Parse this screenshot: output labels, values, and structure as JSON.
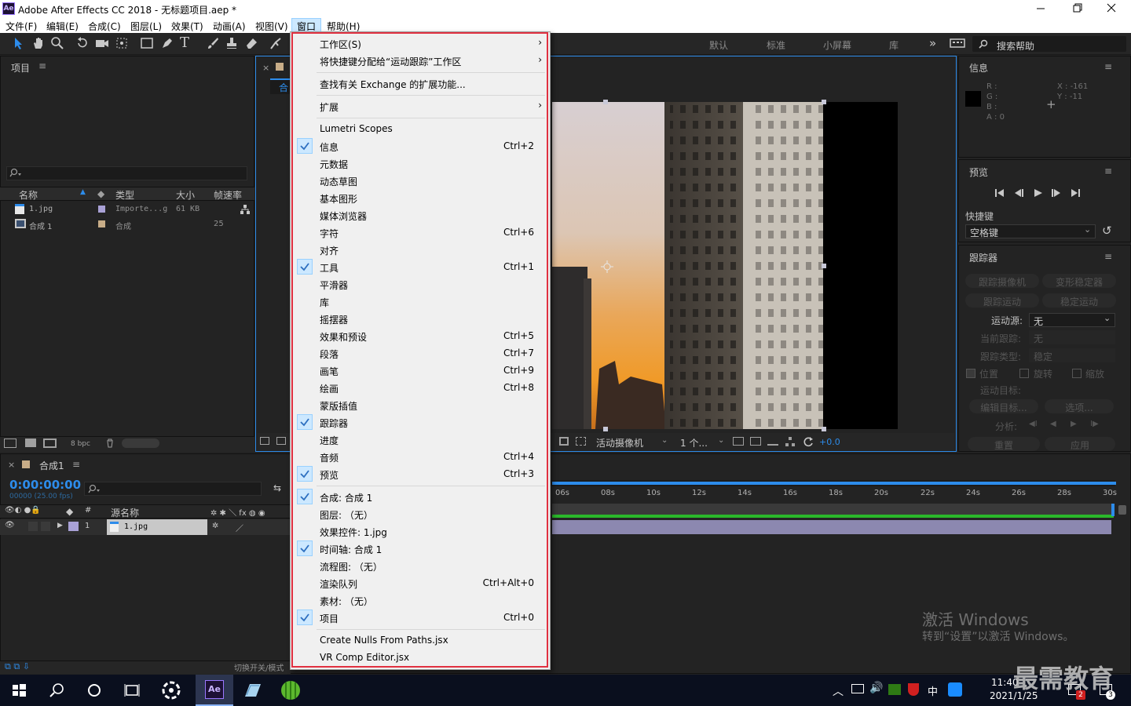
{
  "window": {
    "app_badge": "Ae",
    "title": "Adobe After Effects CC 2018 - 无标题项目.aep *"
  },
  "menubar": [
    "文件(F)",
    "编辑(E)",
    "合成(C)",
    "图层(L)",
    "效果(T)",
    "动画(A)",
    "视图(V)",
    "窗口",
    "帮助(H)"
  ],
  "workspaces": {
    "items": [
      "默认",
      "标准",
      "小屏幕",
      "库"
    ],
    "more": "»",
    "search_placeholder": "搜索帮助"
  },
  "project": {
    "title": "项目",
    "columns": [
      "名称",
      "类型",
      "大小",
      "帧速率"
    ],
    "rows": [
      {
        "name": "1.jpg",
        "type": "Importe...g",
        "size": "61 KB",
        "fps": ""
      },
      {
        "name": "合成 1",
        "type": "合成",
        "size": "",
        "fps": "25"
      }
    ],
    "bpc": "8 bpc"
  },
  "viewer": {
    "tab_label": "合",
    "camera": "活动摄像机",
    "views": "1 个...",
    "exposure": "+0.0"
  },
  "info": {
    "title": "信息",
    "r": "R :",
    "g": "G :",
    "b": "B :",
    "a": "A : 0",
    "x": "X : -161",
    "y": "Y : -11"
  },
  "preview": {
    "title": "预览",
    "shortcut_label": "快捷键",
    "shortcut_value": "空格键"
  },
  "tracker": {
    "title": "跟踪器",
    "track_camera": "跟踪摄像机",
    "warp_stabilizer": "变形稳定器",
    "track_motion": "跟踪运动",
    "stabilize_motion": "稳定运动",
    "motion_source_label": "运动源:",
    "motion_source": "无",
    "current_track_label": "当前跟踪:",
    "current_track": "无",
    "track_type_label": "跟踪类型:",
    "track_type": "稳定",
    "position": "位置",
    "rotation": "旋转",
    "scale": "缩放",
    "motion_target": "运动目标:",
    "edit_target": "编辑目标...",
    "options": "选项...",
    "analyze": "分析:",
    "reset": "重置",
    "apply": "应用"
  },
  "timeline": {
    "comp_tab": "合成1",
    "timecode": "0:00:00:00",
    "frames": "00000 (25.00 fps)",
    "layer_col": "源名称",
    "hash_col": "#",
    "layer_num": "1",
    "layer_name": "1.jpg",
    "ruler": [
      "06s",
      "08s",
      "10s",
      "12s",
      "14s",
      "16s",
      "18s",
      "20s",
      "22s",
      "24s",
      "26s",
      "28s",
      "30s"
    ],
    "footer": "切换开关/模式"
  },
  "window_menu": {
    "items": [
      {
        "label": "工作区(S)",
        "shortcut": "",
        "submenu": true,
        "checked": false
      },
      {
        "label": "将快捷键分配给“运动跟踪”工作区",
        "shortcut": "",
        "submenu": true,
        "checked": false
      },
      {
        "label": "查找有关 Exchange 的扩展功能...",
        "shortcut": "",
        "submenu": false,
        "checked": false
      },
      {
        "label": "扩展",
        "shortcut": "",
        "submenu": true,
        "checked": false
      },
      {
        "label": "Lumetri Scopes",
        "shortcut": "",
        "submenu": false,
        "checked": false
      },
      {
        "label": "信息",
        "shortcut": "Ctrl+2",
        "submenu": false,
        "checked": true
      },
      {
        "label": "元数据",
        "shortcut": "",
        "submenu": false,
        "checked": false
      },
      {
        "label": "动态草图",
        "shortcut": "",
        "submenu": false,
        "checked": false
      },
      {
        "label": "基本图形",
        "shortcut": "",
        "submenu": false,
        "checked": false
      },
      {
        "label": "媒体浏览器",
        "shortcut": "",
        "submenu": false,
        "checked": false
      },
      {
        "label": "字符",
        "shortcut": "Ctrl+6",
        "submenu": false,
        "checked": false
      },
      {
        "label": "对齐",
        "shortcut": "",
        "submenu": false,
        "checked": false
      },
      {
        "label": "工具",
        "shortcut": "Ctrl+1",
        "submenu": false,
        "checked": true
      },
      {
        "label": "平滑器",
        "shortcut": "",
        "submenu": false,
        "checked": false
      },
      {
        "label": "库",
        "shortcut": "",
        "submenu": false,
        "checked": false
      },
      {
        "label": "摇摆器",
        "shortcut": "",
        "submenu": false,
        "checked": false
      },
      {
        "label": "效果和预设",
        "shortcut": "Ctrl+5",
        "submenu": false,
        "checked": false
      },
      {
        "label": "段落",
        "shortcut": "Ctrl+7",
        "submenu": false,
        "checked": false
      },
      {
        "label": "画笔",
        "shortcut": "Ctrl+9",
        "submenu": false,
        "checked": false
      },
      {
        "label": "绘画",
        "shortcut": "Ctrl+8",
        "submenu": false,
        "checked": false
      },
      {
        "label": "蒙版插值",
        "shortcut": "",
        "submenu": false,
        "checked": false
      },
      {
        "label": "跟踪器",
        "shortcut": "",
        "submenu": false,
        "checked": true
      },
      {
        "label": "进度",
        "shortcut": "",
        "submenu": false,
        "checked": false
      },
      {
        "label": "音频",
        "shortcut": "Ctrl+4",
        "submenu": false,
        "checked": false
      },
      {
        "label": "预览",
        "shortcut": "Ctrl+3",
        "submenu": false,
        "checked": true
      },
      {
        "label": "合成: 合成 1",
        "shortcut": "",
        "submenu": false,
        "checked": true
      },
      {
        "label": "图层: （无）",
        "shortcut": "",
        "submenu": false,
        "checked": false
      },
      {
        "label": "效果控件: 1.jpg",
        "shortcut": "",
        "submenu": false,
        "checked": false
      },
      {
        "label": "时间轴: 合成 1",
        "shortcut": "",
        "submenu": false,
        "checked": true
      },
      {
        "label": "流程图: （无）",
        "shortcut": "",
        "submenu": false,
        "checked": false
      },
      {
        "label": "渲染队列",
        "shortcut": "Ctrl+Alt+0",
        "submenu": false,
        "checked": false
      },
      {
        "label": "素材: （无）",
        "shortcut": "",
        "submenu": false,
        "checked": false
      },
      {
        "label": "项目",
        "shortcut": "Ctrl+0",
        "submenu": false,
        "checked": true
      },
      {
        "label": "Create Nulls From Paths.jsx",
        "shortcut": "",
        "submenu": false,
        "checked": false
      },
      {
        "label": "VR Comp Editor.jsx",
        "shortcut": "",
        "submenu": false,
        "checked": false
      }
    ]
  },
  "watermark": {
    "line1": "激活 Windows",
    "line2": "转到“设置”以激活 Windows。",
    "brand": "最需教育"
  },
  "taskbar": {
    "time": "11:40",
    "date": "2021/1/25",
    "ime": "中",
    "ae_badge": "Ae",
    "notif_count": "3",
    "badge_count": "2"
  },
  "colors": {
    "accent": "#2d8ceb",
    "menu_highlight": "#cce8ff",
    "outline_red": "#e03040",
    "timecode_blue": "#2d8ceb"
  }
}
